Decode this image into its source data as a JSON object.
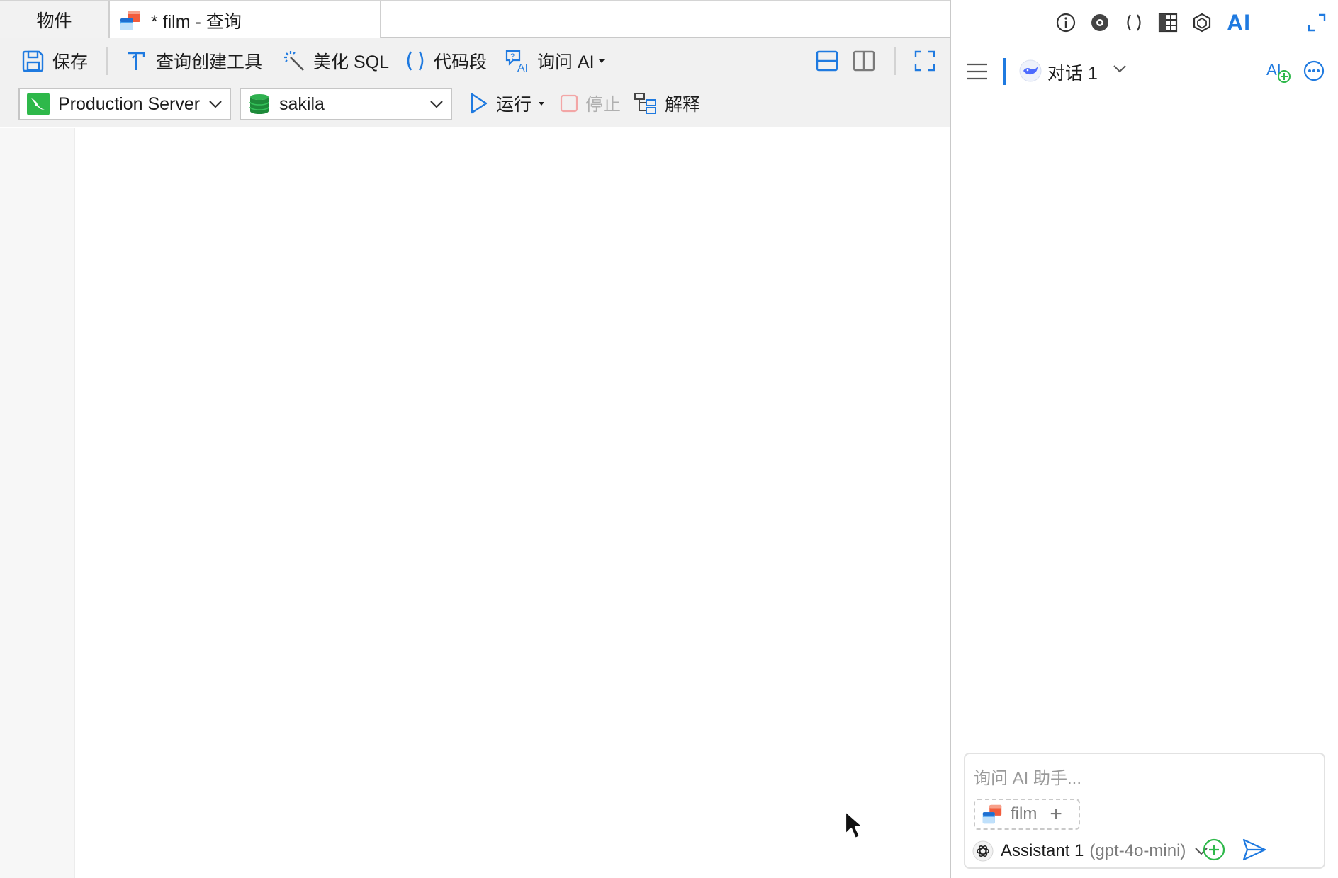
{
  "tabs": {
    "objects_label": "物件",
    "query_label": "* film - 查询"
  },
  "toolbar": {
    "save_label": "保存",
    "query_builder_label": "查询创建工具",
    "beautify_label": "美化 SQL",
    "snippet_label": "代码段",
    "ask_ai_label": "询问 AI",
    "run_label": "运行",
    "stop_label": "停止",
    "explain_label": "解释"
  },
  "connection": {
    "server": "Production Server",
    "database": "sakila"
  },
  "ai_panel": {
    "conversation_title": "对话 1",
    "input_placeholder": "询问 AI 助手...",
    "context_chip_label": "film",
    "model_name": "Assistant 1",
    "model_detail": "(gpt-4o-mini)",
    "ai_tab_label": "AI"
  },
  "colors": {
    "accent_blue": "#1f7ae0",
    "green": "#2eb84a",
    "toolbar_bg": "#f1f1f1",
    "disabled": "#b0b0b0"
  },
  "icons": {
    "save": "floppy-disk-icon",
    "query_builder": "builder-icon",
    "beautify": "magic-wand-icon",
    "snippet": "parentheses-icon",
    "ask_ai": "ai-question-icon",
    "run": "play-icon",
    "stop": "stop-icon",
    "explain": "explain-tree-icon"
  }
}
